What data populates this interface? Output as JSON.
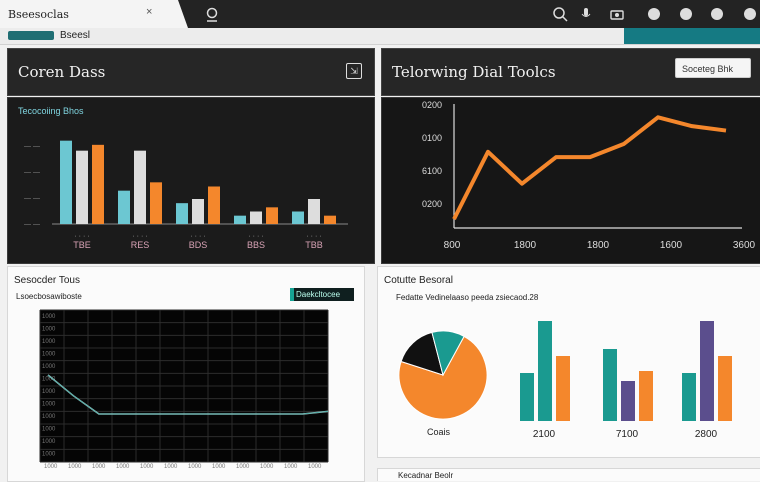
{
  "browser": {
    "tab_title": "Bseesoclas",
    "tab_close": "×"
  },
  "toolbar": {
    "label": "Bseesl"
  },
  "panels": {
    "top_left": {
      "title": "Coren Dass",
      "subtitle": "Tecocoiing Bhos"
    },
    "top_right": {
      "title": "Telorwing Dial Toolcs",
      "sort_button": "Soceteg Bhk"
    },
    "bottom_left": {
      "title": "Sesocder Tous",
      "subtitle": "Lsoecbosawiboste",
      "button": "Daekcltocee"
    },
    "bottom_right": {
      "title": "Cotutte Besoral",
      "subtitle": "Fedatte Vedinelaaso peeda zsiecaod.28",
      "pie_label": "Coais"
    },
    "footer": {
      "text": "Kecadnar Beolr"
    }
  },
  "colors": {
    "teal": "#1a9a90",
    "orange": "#f4872c",
    "light_blue": "#6cc7d2",
    "purple": "#5b4e8d",
    "dark_bg": "#1b1b1b"
  },
  "chart_data": [
    {
      "type": "bar",
      "title": "Tecocoiing Bhos",
      "categories": [
        "TBE",
        "RES",
        "BDS",
        "BBS",
        "TBB"
      ],
      "series": [
        {
          "values": [
            100,
            40,
            25,
            10,
            15
          ]
        },
        {
          "values": [
            88,
            88,
            30,
            15,
            30
          ]
        },
        {
          "values": [
            95,
            50,
            45,
            20,
            10
          ]
        }
      ],
      "ylim": [
        0,
        120
      ],
      "tick_labels": [
        "TBE",
        "RES",
        "BDS",
        "BBS",
        "TBB"
      ]
    },
    {
      "type": "line",
      "title": "Telorwing Dial Toolcs",
      "x": [
        1,
        2,
        3,
        4,
        5,
        6,
        7,
        8,
        9
      ],
      "y": [
        10,
        86,
        50,
        80,
        80,
        95,
        125,
        115,
        110
      ],
      "y_ticks": [
        "0200",
        "0100",
        "6100",
        "0200"
      ],
      "x_ticks": [
        "800",
        "1800",
        "1800",
        "1600",
        "3600"
      ],
      "ylim": [
        0,
        140
      ]
    },
    {
      "type": "line",
      "title": "Sesocder Tous",
      "x": [
        0,
        1,
        2,
        3,
        4,
        5,
        6,
        7,
        8,
        9,
        10,
        11
      ],
      "y": [
        20,
        12,
        5,
        5,
        5,
        5,
        5,
        5,
        5,
        5,
        5,
        6
      ],
      "y_ticks": [
        "1000",
        "1000",
        "1000",
        "1000",
        "1000",
        "1000",
        "1000",
        "1000",
        "1000",
        "1000",
        "1000",
        "1000"
      ],
      "x_ticks": [
        "1000",
        "1000",
        "1000",
        "1000",
        "1000",
        "1000",
        "1000",
        "1000",
        "1000",
        "1000",
        "1000",
        "1000"
      ],
      "ylim": [
        0,
        100
      ]
    },
    {
      "type": "pie",
      "title": "Cotutte Besoral",
      "slices": [
        {
          "value": 72,
          "color": "#f4872c"
        },
        {
          "value": 16,
          "color": "#111111"
        },
        {
          "value": 12,
          "color": "#1a9a90"
        }
      ]
    },
    {
      "type": "bar",
      "categories": [
        "2100",
        "7100",
        "2800"
      ],
      "series": [
        {
          "values": [
            48,
            72,
            48
          ]
        },
        {
          "values": [
            100,
            40,
            100
          ]
        },
        {
          "values": [
            65,
            50,
            65
          ]
        }
      ],
      "ylim": [
        0,
        110
      ]
    }
  ]
}
